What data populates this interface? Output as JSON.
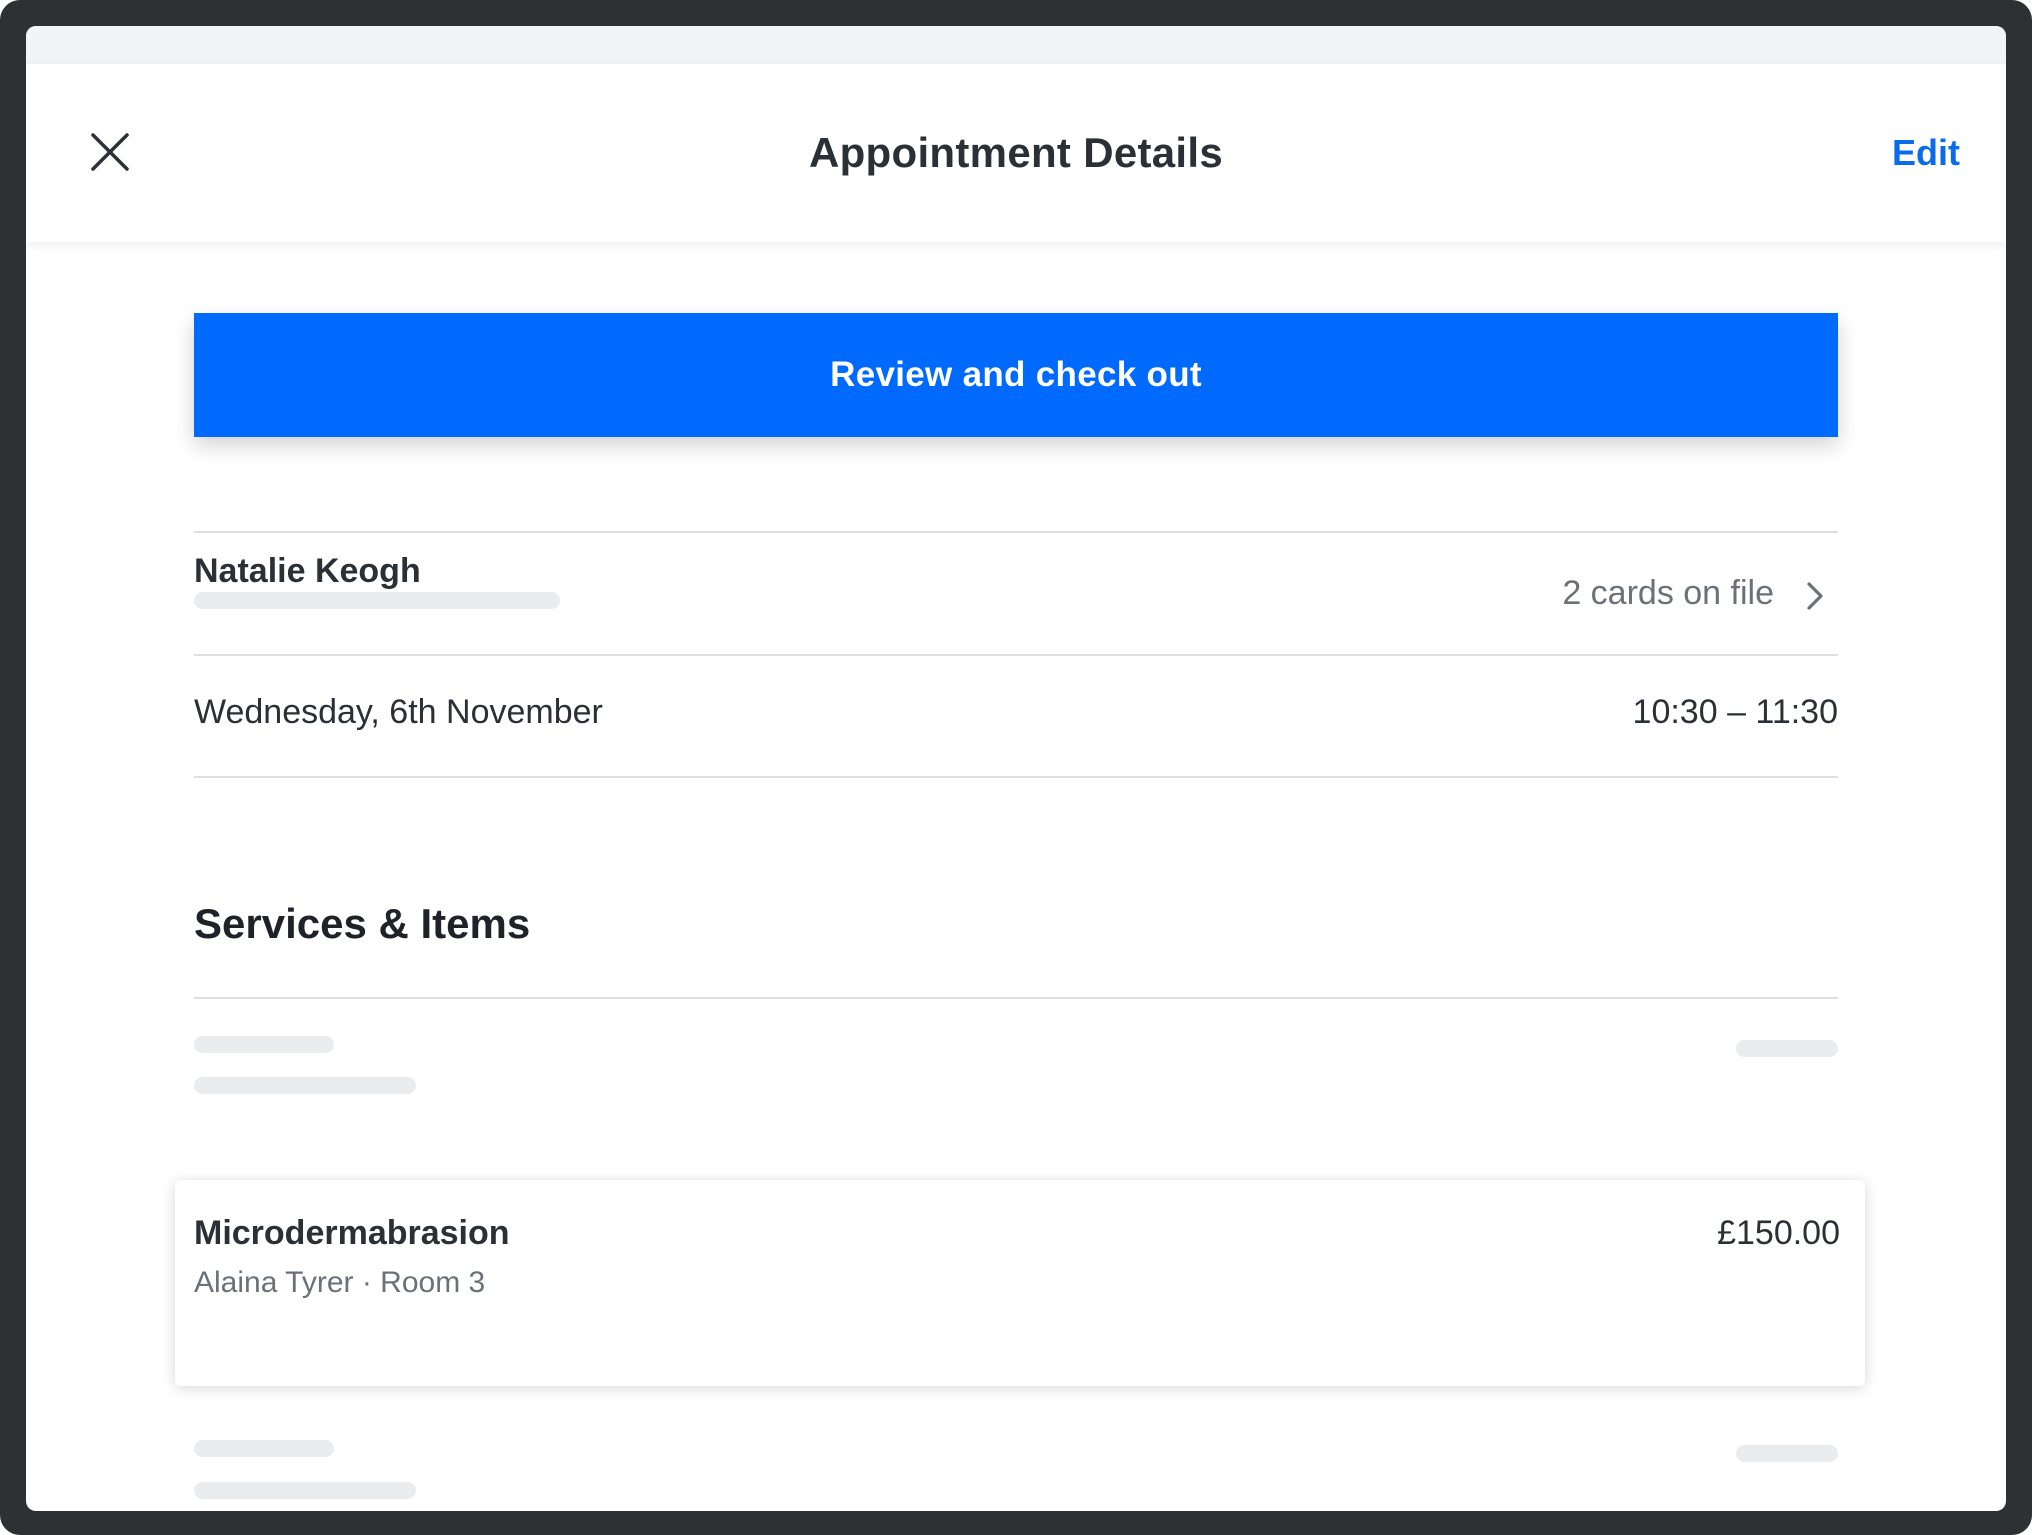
{
  "header": {
    "title": "Appointment Details",
    "edit_label": "Edit",
    "close_icon": "close-icon"
  },
  "checkout": {
    "button_label": "Review and check out"
  },
  "customer": {
    "name": "Natalie Keogh",
    "cards_on_file": "2 cards on file",
    "chevron_icon": "chevron-right-icon"
  },
  "appointment": {
    "date": "Wednesday, 6th November",
    "time": "10:30 – 11:30"
  },
  "services_section": {
    "title": "Services & Items",
    "items": [
      {
        "name": "Microdermabrasion",
        "subtitle": "Alaina Tyrer · Room 3",
        "price": "£150.00"
      }
    ]
  },
  "colors": {
    "accent": "#006aff",
    "link": "#0a6ce8",
    "text_primary": "#2b3036",
    "text_secondary": "#6b7178",
    "divider": "#dcdfe2",
    "skeleton": "#ebecee",
    "frame": "#2f3031"
  }
}
